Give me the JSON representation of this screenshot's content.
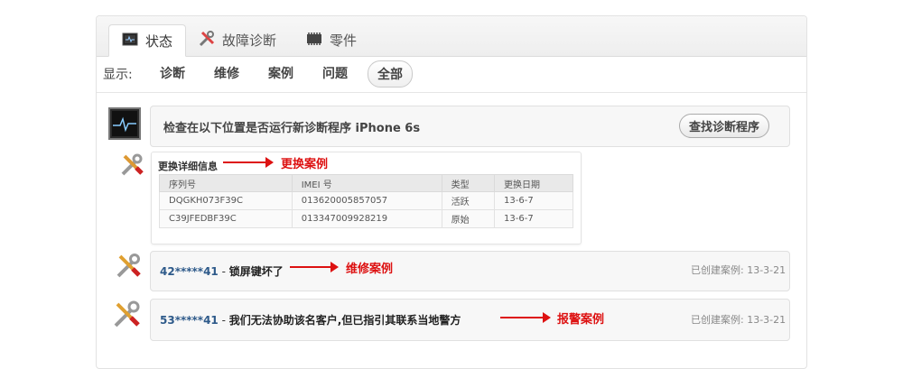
{
  "tabs": [
    {
      "label": "状态",
      "icon": "monitor-icon",
      "active": true
    },
    {
      "label": "故障诊断",
      "icon": "tools-icon",
      "active": false
    },
    {
      "label": "零件",
      "icon": "chip-icon",
      "active": false
    }
  ],
  "filter": {
    "label": "显示:",
    "options": [
      "诊断",
      "维修",
      "案例",
      "问题",
      "全部"
    ],
    "selected": "全部"
  },
  "diagnostic": {
    "message": "检查在以下位置是否运行新诊断程序 iPhone 6s",
    "button_label": "查找诊断程序"
  },
  "replacement": {
    "title": "更换详细信息",
    "annotation": "更换案例",
    "columns": [
      "序列号",
      "IMEI 号",
      "类型",
      "更换日期"
    ],
    "rows": [
      [
        "DQGKH073F39C",
        "013620005857057",
        "活跃",
        "13-6-7"
      ],
      [
        "C39JFEDBF39C",
        "013347009928219",
        "原始",
        "13-6-7"
      ]
    ]
  },
  "cases": [
    {
      "id": "42*****41",
      "text": "锁屏键坏了",
      "annotation": "维修案例",
      "created_label": "已创建案例:",
      "created_date": "13-3-21"
    },
    {
      "id": "53*****41",
      "text": "我们无法协助该名客户,但已指引其联系当地警方",
      "annotation": "报警案例",
      "created_label": "已创建案例:",
      "created_date": "13-3-21"
    }
  ],
  "colors": {
    "annotation": "#dd1111",
    "case_id": "#2e5a8a"
  }
}
